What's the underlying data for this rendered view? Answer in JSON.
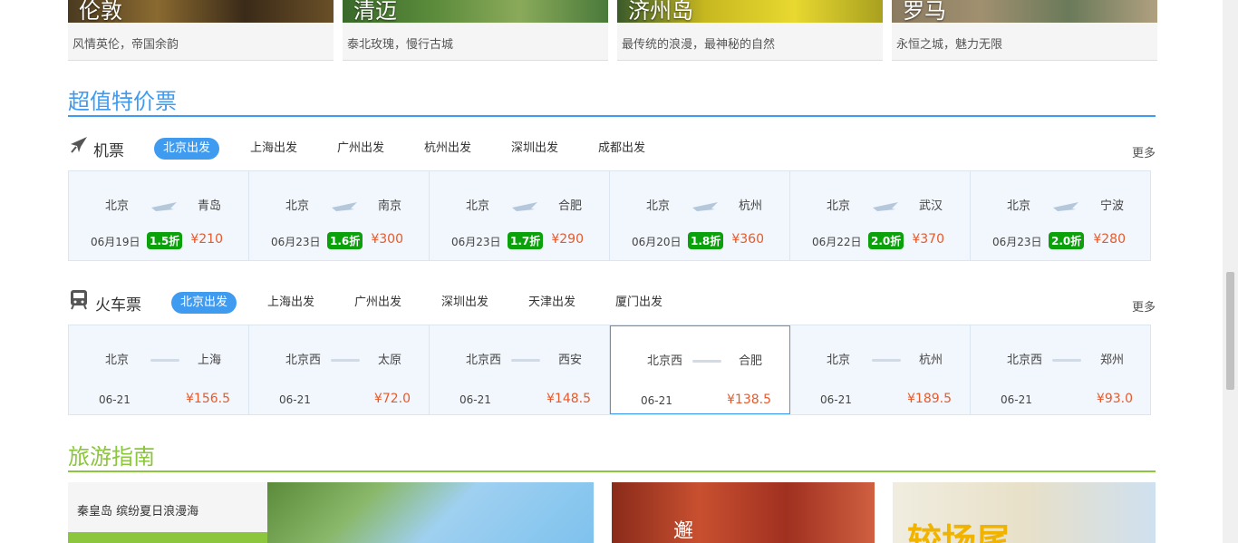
{
  "destinations": [
    {
      "name": "伦敦",
      "desc": "风情英伦，帝国余韵"
    },
    {
      "name": "清迈",
      "desc": "泰北玫瑰，慢行古城"
    },
    {
      "name": "济州岛",
      "desc": "最传统的浪漫，最神秘的自然"
    },
    {
      "name": "罗马",
      "desc": "永恒之城，魅力无限"
    }
  ],
  "deals": {
    "title": "超值特价票",
    "color": "#3f9bf0"
  },
  "flights": {
    "label": "机票",
    "tabs": [
      "北京出发",
      "上海出发",
      "广州出发",
      "杭州出发",
      "深圳出发",
      "成都出发"
    ],
    "more": "更多",
    "cards": [
      {
        "from": "北京",
        "to": "青岛",
        "date": "06月19日",
        "discount": "1.5折",
        "price": "¥210"
      },
      {
        "from": "北京",
        "to": "南京",
        "date": "06月23日",
        "discount": "1.6折",
        "price": "¥300"
      },
      {
        "from": "北京",
        "to": "合肥",
        "date": "06月23日",
        "discount": "1.7折",
        "price": "¥290"
      },
      {
        "from": "北京",
        "to": "杭州",
        "date": "06月20日",
        "discount": "1.8折",
        "price": "¥360"
      },
      {
        "from": "北京",
        "to": "武汉",
        "date": "06月22日",
        "discount": "2.0折",
        "price": "¥370"
      },
      {
        "from": "北京",
        "to": "宁波",
        "date": "06月23日",
        "discount": "2.0折",
        "price": "¥280"
      }
    ]
  },
  "trains": {
    "label": "火车票",
    "tabs": [
      "北京出发",
      "上海出发",
      "广州出发",
      "深圳出发",
      "天津出发",
      "厦门出发"
    ],
    "more": "更多",
    "cards": [
      {
        "from": "北京",
        "to": "上海",
        "date": "06-21",
        "price": "¥156.5"
      },
      {
        "from": "北京西",
        "to": "太原",
        "date": "06-21",
        "price": "¥72.0"
      },
      {
        "from": "北京西",
        "to": "西安",
        "date": "06-21",
        "price": "¥148.5"
      },
      {
        "from": "北京西",
        "to": "合肥",
        "date": "06-21",
        "price": "¥138.5"
      },
      {
        "from": "北京",
        "to": "杭州",
        "date": "06-21",
        "price": "¥189.5"
      },
      {
        "from": "北京西",
        "to": "郑州",
        "date": "06-21",
        "price": "¥93.0"
      }
    ]
  },
  "guide": {
    "title": "旅游指南",
    "color": "#8cc63f",
    "side_title": "秦皇岛 缤纷夏日浪漫海",
    "img2_text": "邂",
    "img3_text": "较场尾"
  }
}
